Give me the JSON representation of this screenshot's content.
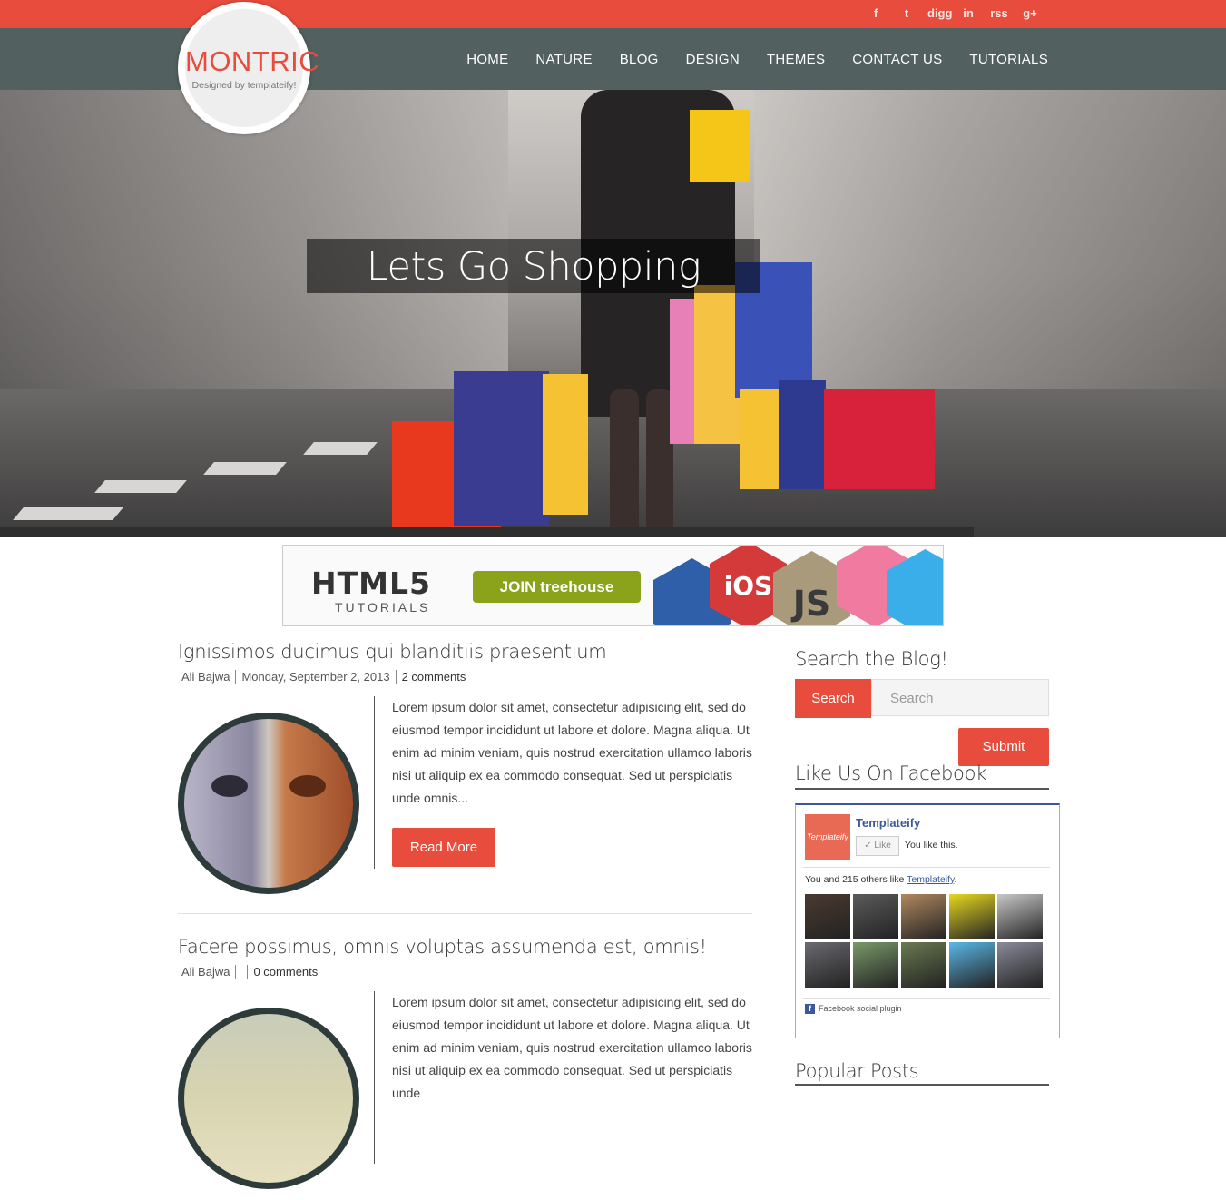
{
  "logo": {
    "title": "MONTRIC",
    "subtitle": "Designed by templateify!"
  },
  "social": [
    "f",
    "t",
    "digg",
    "in",
    "rss",
    "g+"
  ],
  "nav": [
    "HOME",
    "NATURE",
    "BLOG",
    "DESIGN",
    "THEMES",
    "CONTACT US",
    "TUTORIALS"
  ],
  "hero": {
    "caption": "Lets Go Shopping"
  },
  "banner": {
    "title": "HTML5",
    "subtitle": "TUTORIALS",
    "cta": "JOIN treehouse",
    "badges": [
      "iOS",
      "JS"
    ]
  },
  "posts": [
    {
      "title": "Ignissimos ducimus qui blanditiis praesentium",
      "author": "Ali Bajwa",
      "date": "Monday, September 2, 2013",
      "comments": "2 comments",
      "excerpt": "Lorem ipsum dolor sit amet, consectetur adipisicing elit, sed do eiusmod tempor incididunt ut labore et dolore. Magna aliqua. Ut enim ad minim veniam, quis nostrud exercitation ullamco laboris nisi ut aliquip ex ea commodo consequat. Sed ut perspiciatis unde omnis...",
      "read_more": "Read More"
    },
    {
      "title": "Facere possimus, omnis voluptas assumenda est, omnis!",
      "author": "Ali Bajwa",
      "date": "",
      "comments": "0 comments",
      "excerpt": "Lorem ipsum dolor sit amet, consectetur adipisicing elit, sed do eiusmod tempor incididunt ut labore et dolore. Magna aliqua. Ut enim ad minim veniam, quis nostrud exercitation ullamco laboris nisi ut aliquip ex ea commodo consequat. Sed ut perspiciatis unde"
    }
  ],
  "sidebar": {
    "search_heading": "Search the Blog!",
    "search_button": "Search",
    "search_placeholder": "Search",
    "submit": "Submit",
    "facebook_heading": "Like Us On Facebook",
    "fb": {
      "logo_text": "Templateify",
      "page_name": "Templateify",
      "like_button": "Like",
      "you_like": "You like this.",
      "count_text": "You and 215 others like",
      "count_link": "Templateify",
      "count_end": ".",
      "plugin": "Facebook social plugin",
      "face_colors": [
        "#4a3a30",
        "#5b5b5b",
        "#b08860",
        "#e8d820",
        "#c8c8c8",
        "#6a6a70",
        "#7a9a6a",
        "#6a7a50",
        "#5ab8e8",
        "#8a8a9a"
      ]
    },
    "popular_heading": "Popular Posts"
  },
  "colors": {
    "accent": "#e74c3c",
    "nav": "#526060",
    "dark": "#2e3b3b"
  }
}
